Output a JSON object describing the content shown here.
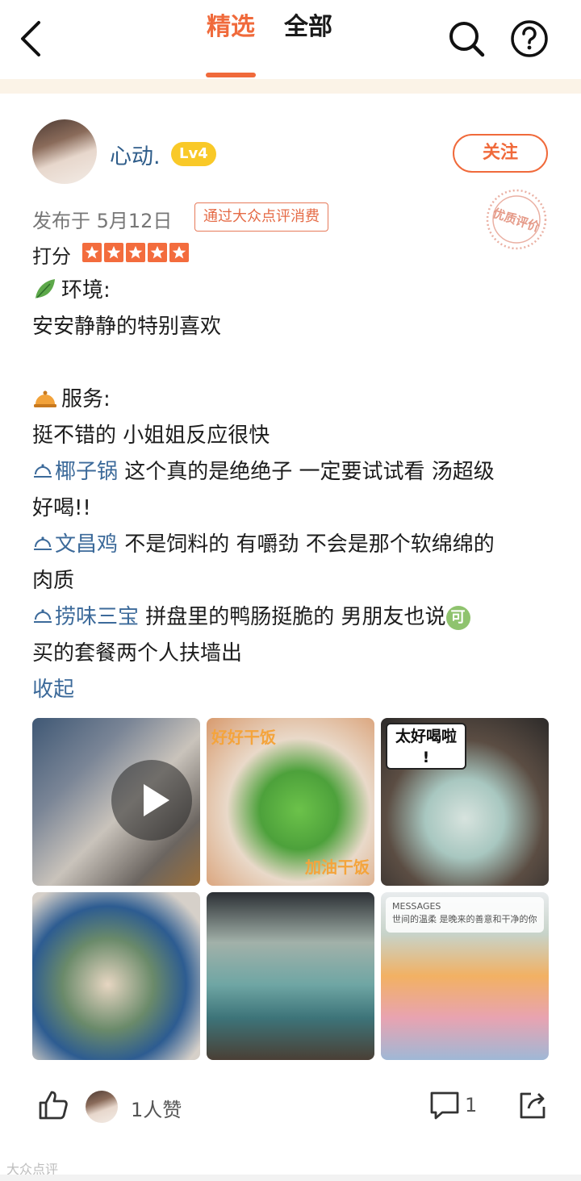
{
  "header": {
    "tabs": [
      {
        "label": "精选",
        "selected": true
      },
      {
        "label": "全部",
        "selected": false
      }
    ],
    "accent_color": "#f06a3b"
  },
  "post": {
    "user": {
      "name": "心动.",
      "level": "Lv4"
    },
    "follow_label": "关注",
    "quality_stamp": "优质评价",
    "date": "发布于 5月12日",
    "verified_tag": "通过大众点评消费",
    "rating_label": "打分",
    "rating_stars": 5,
    "lines": {
      "env_title": "环境:",
      "env_text": "安安静静的特别喜欢",
      "service_title": "服务:",
      "service_text": "挺不错的 小姐姐反应很快",
      "dish1_name": "椰子锅",
      "dish1_text": " 这个真的是绝绝子 一定要试试看 汤超级",
      "dish1_text2": "好喝!!",
      "dish2_name": "文昌鸡",
      "dish2_text": " 不是饲料的 有嚼劲 不会是那个软绵绵的",
      "dish2_text2": "肉质",
      "dish3_name": "捞味三宝",
      "dish3_text": " 拼盘里的鸭肠挺脆的 男朋友也说",
      "ke_emoji": "可",
      "dish3_text2": "买的套餐两个人扶墙出",
      "collapse": "收起"
    },
    "photos": {
      "p2_top_caption": "好好干饭",
      "p2_bottom_caption": "加油干饭",
      "p3_bubble": "太好喝啦\n!",
      "p6_banner_title": "MESSAGES",
      "p6_banner_text": "世间的温柔 是晚来的善意和干净的你"
    },
    "footer": {
      "like_count": "1人赞",
      "comment_count": "1"
    }
  },
  "watermark": "大众点评"
}
